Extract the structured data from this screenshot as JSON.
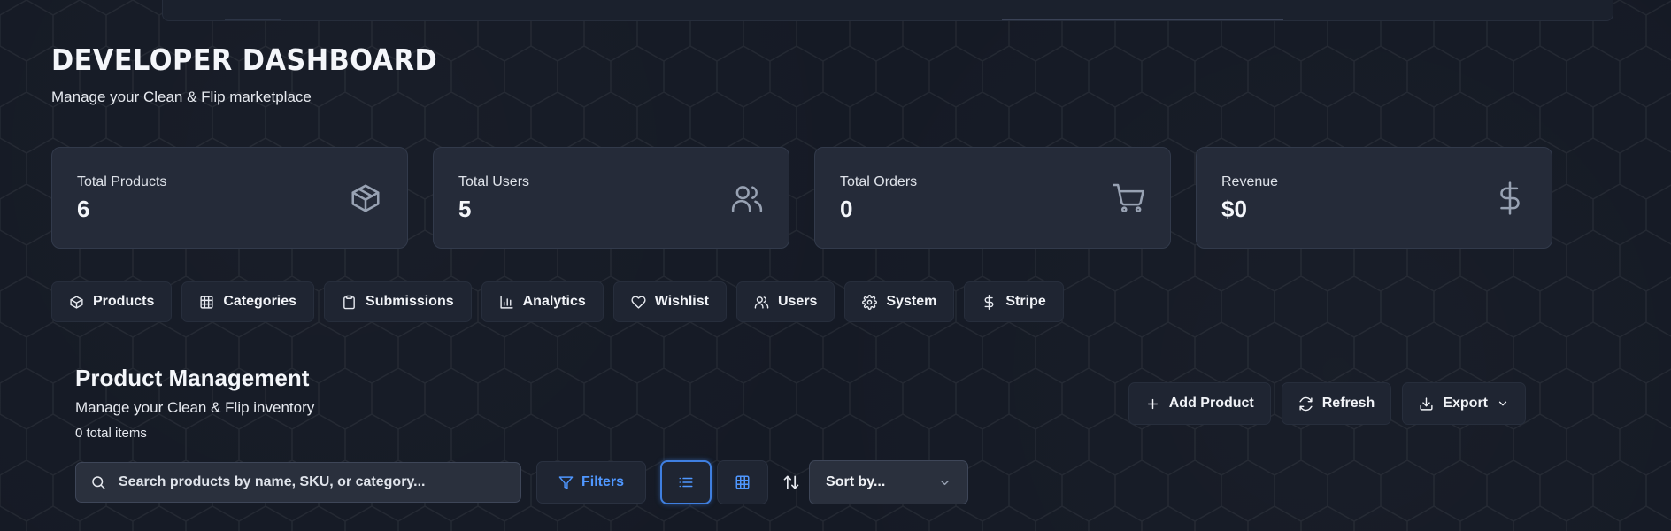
{
  "header": {
    "title": "DEVELOPER DASHBOARD",
    "subtitle": "Manage your Clean & Flip marketplace"
  },
  "stats": [
    {
      "label": "Total Products",
      "value": "6",
      "icon": "box-icon"
    },
    {
      "label": "Total Users",
      "value": "5",
      "icon": "users-icon"
    },
    {
      "label": "Total Orders",
      "value": "0",
      "icon": "cart-icon"
    },
    {
      "label": "Revenue",
      "value": "$0",
      "icon": "dollar-icon"
    }
  ],
  "tabs": [
    {
      "label": "Products",
      "icon": "box-icon"
    },
    {
      "label": "Categories",
      "icon": "grid-icon"
    },
    {
      "label": "Submissions",
      "icon": "clipboard-icon"
    },
    {
      "label": "Analytics",
      "icon": "bar-chart-icon"
    },
    {
      "label": "Wishlist",
      "icon": "heart-icon"
    },
    {
      "label": "Users",
      "icon": "users-icon"
    },
    {
      "label": "System",
      "icon": "gear-icon"
    },
    {
      "label": "Stripe",
      "icon": "dollar-icon"
    }
  ],
  "product_management": {
    "title": "Product Management",
    "subtitle": "Manage your Clean & Flip inventory",
    "count": "0 total items",
    "actions": {
      "add_label": "Add Product",
      "refresh_label": "Refresh",
      "export_label": "Export"
    },
    "search": {
      "placeholder": "Search products by name, SKU, or category...",
      "value": ""
    },
    "filters_label": "Filters",
    "sort": {
      "value": "Sort by..."
    }
  },
  "colors": {
    "accent": "#4f97ff",
    "background": "#151a25",
    "card": "#252b39"
  }
}
